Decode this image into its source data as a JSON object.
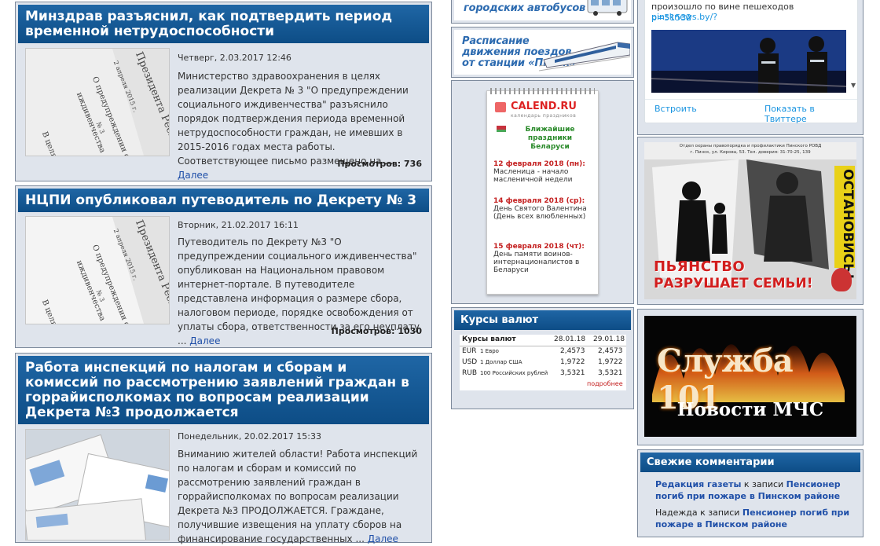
{
  "news": [
    {
      "title": "Минздрав разъяснил, как подтвердить период временной нетрудоспособности",
      "date": "Четверг, 2.03.2017 12:46",
      "text": "Министерство здравоохранения в целях реализации Декрета № 3 \"О предупреждении социального иждивенчества\" разъяснило порядок подтверждения периода временной нетрудоспособности граждан, не имевших в 2015-2016 годах места работы. Соответствующее письмо размещено на ...",
      "more": "Далее",
      "views": "Просмотров: 736"
    },
    {
      "title": "НЦПИ опубликовал путеводитель по Декрету № 3",
      "date": "Вторник, 21.02.2017 16:11",
      "text": "Путеводитель по Декрету №3 \"О предупреждении социального иждивенчества\" опубликован на Национальном правовом интернет-портале. В путеводителе представлена информация о размере сбора, налоговом периоде, порядке освобождения от уплаты сбора, ответственности за его неуплату ...",
      "more": "Далее",
      "views": "Просмотров: 1030"
    },
    {
      "title": "Работа инспекций по налогам и сборам и комиссий по рассмотрению заявлений граждан в горрайисполкомах по вопросам реализации Декрета №3 продолжается",
      "date": "Понедельник, 20.02.2017 15:33",
      "text": "Вниманию жителей области! Работа инспекций по налогам и сборам и комиссий по рассмотрению заявлений граждан в горрайисполкомах  по вопросам реализации Декрета №3 ПРОДОЛЖАЕТСЯ. Граждане, получившие извещения на уплату сборов на финансирование государственных ...",
      "more": "Далее"
    }
  ],
  "thumb_doc": {
    "line1": "Президента Респ",
    "line2": "2 апреля 2015 г.",
    "line3": "О предупреждении социального",
    "line4": "иждивенчества",
    "line5": "№ 3",
    "line6": "В целях предупреж"
  },
  "banners": {
    "bus": "городских автобусов",
    "train_line1": "Расписание",
    "train_line2": "движения поездов",
    "train_line3": "от станции «Пинск»"
  },
  "calend": {
    "logo": "CALEND.RU",
    "logo_sub": "календарь праздников",
    "heading": "Ближайшие праздники Беларуси",
    "events": [
      {
        "date": "12 февраля 2018 (пн):",
        "name": "Масленица - начало масленичной недели"
      },
      {
        "date": "14 февраля 2018 (ср):",
        "name": "День Святого Валентина (День всех влюбленных)"
      },
      {
        "date": "15 февраля 2018 (чт):",
        "name": "День памяти воинов-интернационалистов в Беларуси"
      }
    ]
  },
  "rates": {
    "heading": "Курсы валют",
    "table_title": "Курсы валют",
    "date1": "28.01.18",
    "date2": "29.01.18",
    "rows": [
      {
        "code": "EUR",
        "name": "1 Евро",
        "v1": "2,4573",
        "v2": "2,4573"
      },
      {
        "code": "USD",
        "name": "1 Доллар США",
        "v1": "1,9722",
        "v2": "1,9722"
      },
      {
        "code": "RUB",
        "name": "100 Российских рублей",
        "v1": "3,5321",
        "v2": "3,5321"
      }
    ],
    "more": "подробнее"
  },
  "twitter": {
    "text_line1": "произошло по вине пешеходов",
    "link": "pinsknews.by/?",
    "link2": "p=51532",
    "embed": "Встроить",
    "view_on": "Показать в Твиттере"
  },
  "poster": {
    "top_text": "Отдел охраны правопорядка и профилактики Пинского РОВД",
    "top_text2": "г. Пинск, ул. Кирова, 53. Тел. доверия: 31-70-25, 139",
    "stop": "ОСТАНОВИСЬ!",
    "bottom1": "ПЬЯНСТВО",
    "bottom2": "РАЗРУШАЕТ СЕМЬИ!"
  },
  "mchs": {
    "title": "Служба 101",
    "subtitle": "Новости МЧС"
  },
  "comments": {
    "heading": "Свежие комментарии",
    "items": [
      {
        "author": "Редакция газеты",
        "mid": " к записи ",
        "post": "Пенсионер погиб при пожаре в Пинском районе"
      },
      {
        "author": "Надежда",
        "mid": " к записи ",
        "post": "Пенсионер погиб при пожаре в Пинском районе"
      }
    ]
  }
}
